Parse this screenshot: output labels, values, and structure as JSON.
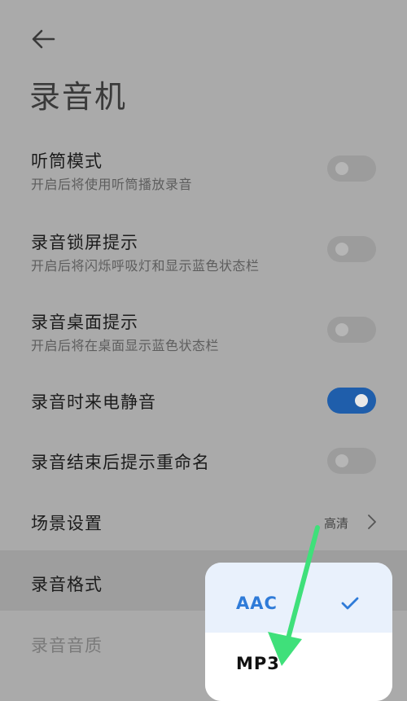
{
  "page": {
    "title": "录音机"
  },
  "settings": [
    {
      "label": "听筒模式",
      "sub": "开启后将使用听筒播放录音",
      "toggle": false
    },
    {
      "label": "录音锁屏提示",
      "sub": "开启后将闪烁呼吸灯和显示蓝色状态栏",
      "toggle": false
    },
    {
      "label": "录音桌面提示",
      "sub": "开启后将在桌面显示蓝色状态栏",
      "toggle": false
    },
    {
      "label": "录音时来电静音",
      "toggle": true
    },
    {
      "label": "录音结束后提示重命名",
      "toggle": false
    }
  ],
  "scene": {
    "label": "场景设置",
    "value": "高清"
  },
  "format": {
    "label": "录音格式"
  },
  "quality": {
    "label": "录音音质"
  },
  "format_menu": {
    "options": [
      {
        "label": "AAC",
        "selected": true
      },
      {
        "label": "MP3",
        "selected": false
      }
    ]
  },
  "colors": {
    "accent": "#2f7bd8",
    "toggle_on": "#1f5eab",
    "annotation_arrow": "#3fe07a"
  }
}
